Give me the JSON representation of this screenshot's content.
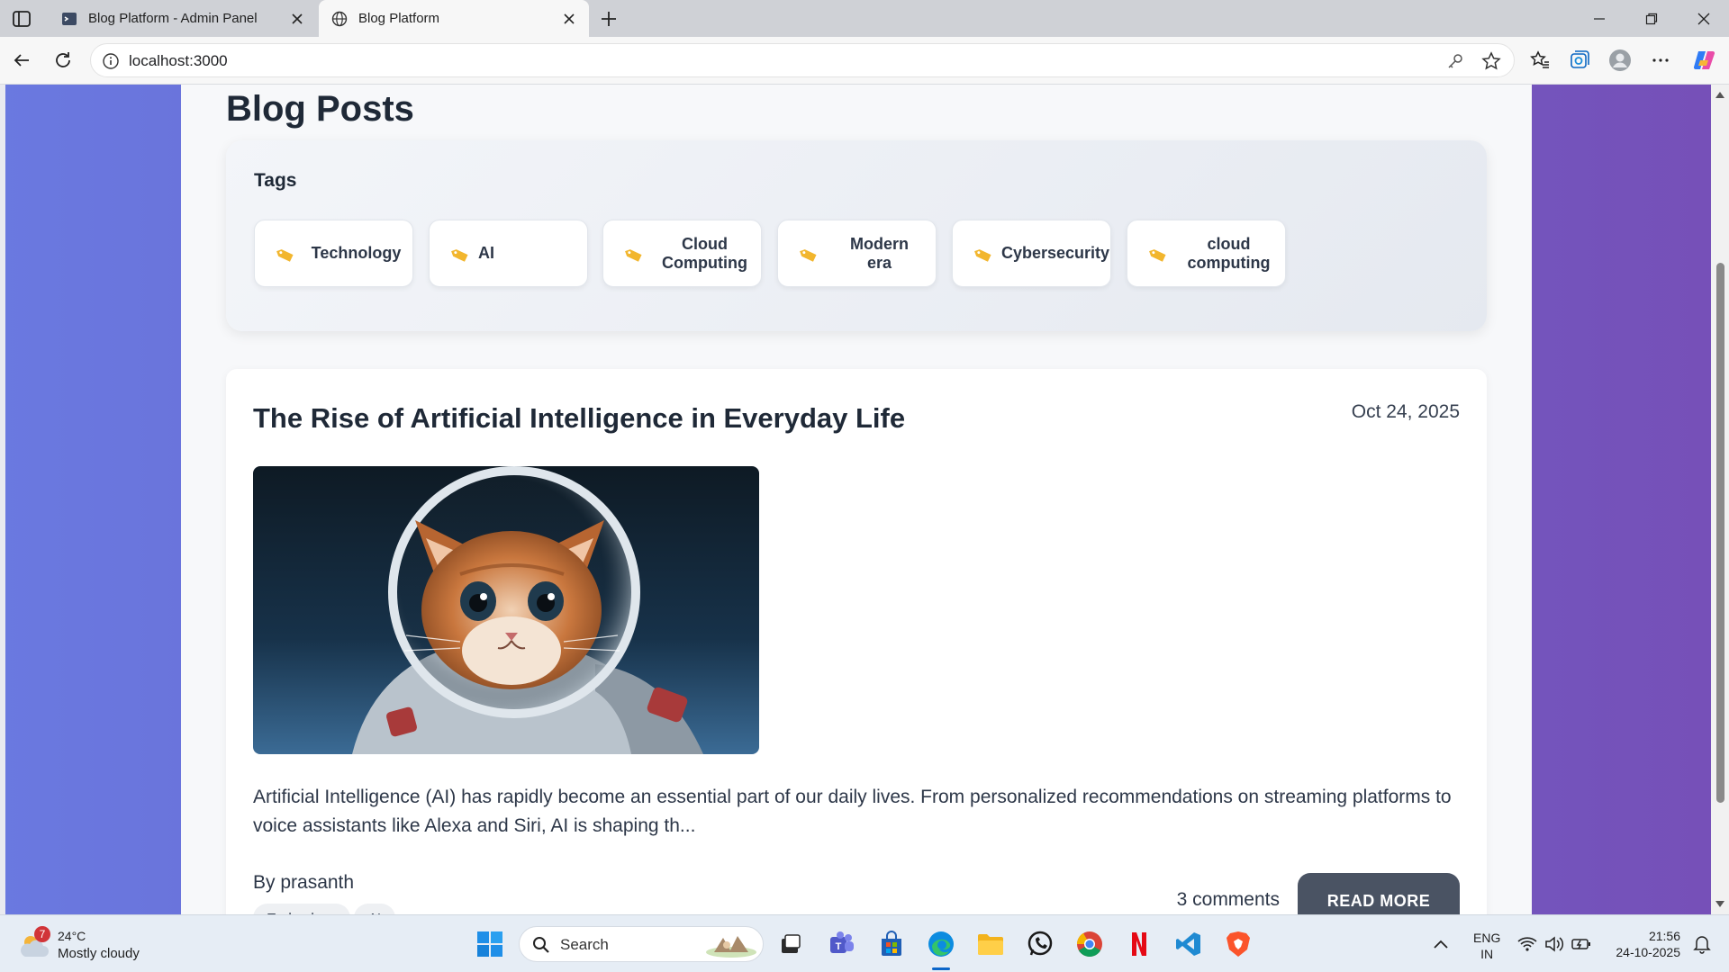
{
  "browser": {
    "tabs": [
      {
        "title": "Blog Platform - Admin Panel",
        "active": false
      },
      {
        "title": "Blog Platform",
        "active": true
      }
    ],
    "url": "localhost:3000"
  },
  "page": {
    "title": "Blog Posts",
    "tags_heading": "Tags",
    "tags": [
      "Technology",
      "AI",
      "Cloud Computing",
      "Modern era",
      "Cybersecurity",
      "cloud computing"
    ]
  },
  "post": {
    "title": "The Rise of Artificial Intelligence in Everyday Life",
    "date": "Oct 24, 2025",
    "excerpt": "Artificial Intelligence (AI) has rapidly become an essential part of our daily lives. From personalized recommendations on streaming platforms to voice assistants like Alexa and Siri, AI is shaping th...",
    "author": "By prasanth",
    "tags": [
      "Technology",
      "AI"
    ],
    "comments": "3 comments",
    "read_more": "READ MORE"
  },
  "taskbar": {
    "weather_temp": "24°C",
    "weather_condition": "Mostly cloudy",
    "weather_badge": "7",
    "search_label": "Search",
    "lang_line1": "ENG",
    "lang_line2": "IN",
    "time": "21:56",
    "date": "24-10-2025"
  },
  "colors": {
    "accent_gradient_left": "#6a79e0",
    "accent_gradient_right": "#7650b8",
    "read_more_bg": "#4a5363"
  }
}
